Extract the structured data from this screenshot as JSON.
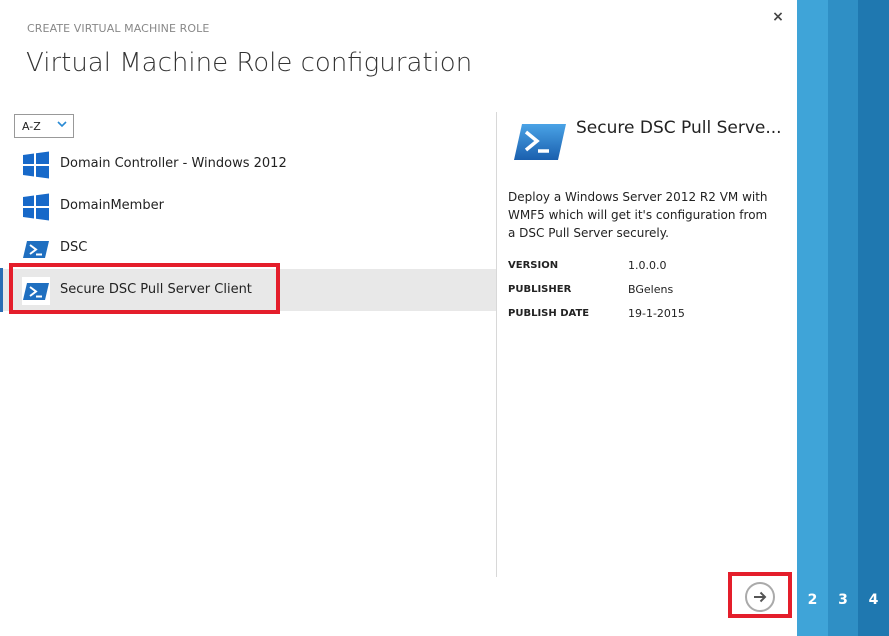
{
  "dialog": {
    "kicker": "CREATE VIRTUAL MACHINE ROLE",
    "title": "Virtual Machine Role configuration",
    "close_label": "×"
  },
  "sort": {
    "selected": "A-Z"
  },
  "items": [
    {
      "label": "Domain Controller - Windows 2012",
      "icon": "windows-logo-icon"
    },
    {
      "label": "DomainMember",
      "icon": "windows-logo-icon"
    },
    {
      "label": "DSC",
      "icon": "powershell-icon"
    },
    {
      "label": "Secure DSC Pull Server Client",
      "icon": "powershell-icon",
      "selected": true
    }
  ],
  "detail": {
    "title": "Secure DSC Pull Serve...",
    "description": "Deploy a Windows Server 2012 R2 VM with WMF5 which will get it's configuration from a DSC Pull Server securely.",
    "meta": [
      {
        "key": "VERSION",
        "value": "1.0.0.0"
      },
      {
        "key": "PUBLISHER",
        "value": "BGelens"
      },
      {
        "key": "PUBLISH DATE",
        "value": "19-1-2015"
      }
    ]
  },
  "steps": [
    "2",
    "3",
    "4"
  ],
  "colors": {
    "accent": "#2a8ad4",
    "highlight": "#e41e2b",
    "step2": "#3fa4d8",
    "step3": "#2f8fc5",
    "step4": "#1f78b0"
  }
}
